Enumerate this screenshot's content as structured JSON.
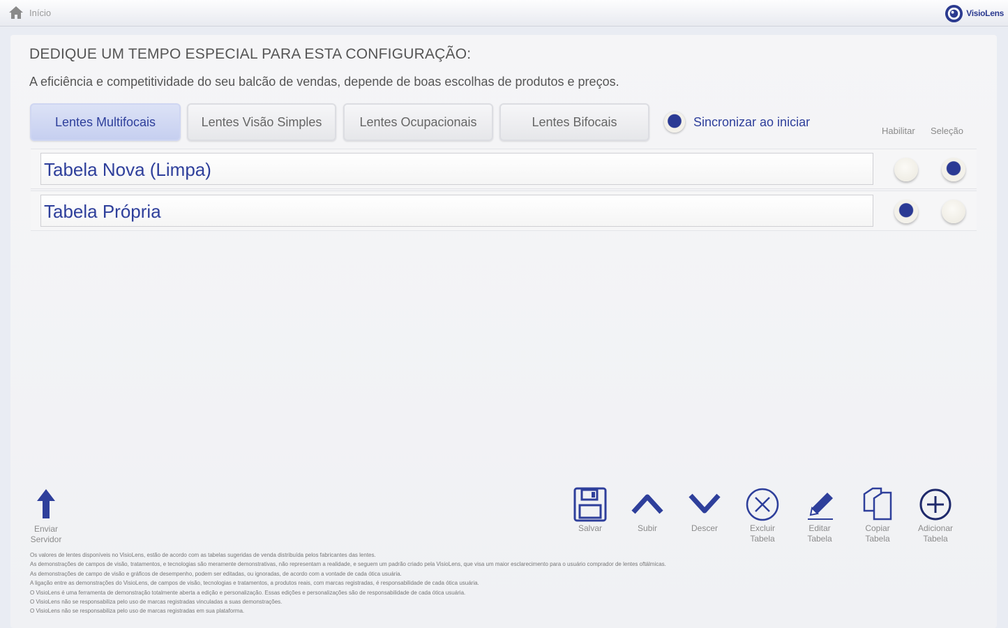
{
  "topbar": {
    "breadcrumb": "Início",
    "logo_text": "VisioLens"
  },
  "heading": "DEDIQUE UM TEMPO ESPECIAL PARA ESTA CONFIGURAÇÃO:",
  "subheading": "A eficiência e competitividade do seu balcão de vendas, depende de boas escolhas de produtos e preços.",
  "tabs": [
    {
      "label": "Lentes Multifocais",
      "active": true
    },
    {
      "label": "Lentes Visão Simples",
      "active": false
    },
    {
      "label": "Lentes Ocupacionais",
      "active": false
    },
    {
      "label": "Lentes Bifocais",
      "active": false
    }
  ],
  "sync": {
    "label": "Sincronizar ao iniciar",
    "checked": true
  },
  "columns": {
    "enable": "Habilitar",
    "select": "Seleção"
  },
  "tables": [
    {
      "name": "Tabela Nova (Limpa)",
      "enabled": false,
      "selected": true
    },
    {
      "name": "Tabela Própria",
      "enabled": true,
      "selected": false
    }
  ],
  "toolbar": {
    "send": {
      "line1": "Enviar",
      "line2": "Servidor"
    },
    "save": {
      "line1": "Salvar",
      "line2": ""
    },
    "up": {
      "line1": "Subir",
      "line2": ""
    },
    "down": {
      "line1": "Descer",
      "line2": ""
    },
    "delete": {
      "line1": "Excluir",
      "line2": "Tabela"
    },
    "edit": {
      "line1": "Editar",
      "line2": "Tabela"
    },
    "copy": {
      "line1": "Copiar",
      "line2": "Tabela"
    },
    "add": {
      "line1": "Adicionar",
      "line2": "Tabela"
    }
  },
  "disclaimer": [
    "Os valores de lentes disponíveis no VisioLens, estão de acordo com as tabelas sugeridas de venda distribuída pelos fabricantes das lentes.",
    "As demonstrações de campos de visão, tratamentos, e tecnologias são meramente demonstrativas, não representam a realidade, e seguem um padrão criado pela VisioLens, que visa um maior esclarecimento para o usuário comprador de lentes oftálmicas.",
    "As demonstrações de campo de visão e gráficos de desempenho, podem ser editadas, ou ignoradas, de acordo com a vontade de cada ótica usuária.",
    "A ligação entre as demonstrações do VisioLens, de campos de visão, tecnologias e tratamentos, a produtos reais, com marcas registradas, é responsabilidade de cada ótica usuária.",
    "O VisioLens é uma ferramenta de demonstração totalmente aberta a edição e personalização. Essas edições e personalizações são de responsabilidade de cada ótica usuária.",
    "O VisioLens não se responsabiliza pelo uso de marcas registradas vinculadas a suas demonstrações.",
    "O VisioLens não se responsabiliza pelo uso de marcas registradas em sua plataforma."
  ],
  "colors": {
    "accent": "#2e3f9b",
    "tab_active_bg": "#c6cff0"
  }
}
